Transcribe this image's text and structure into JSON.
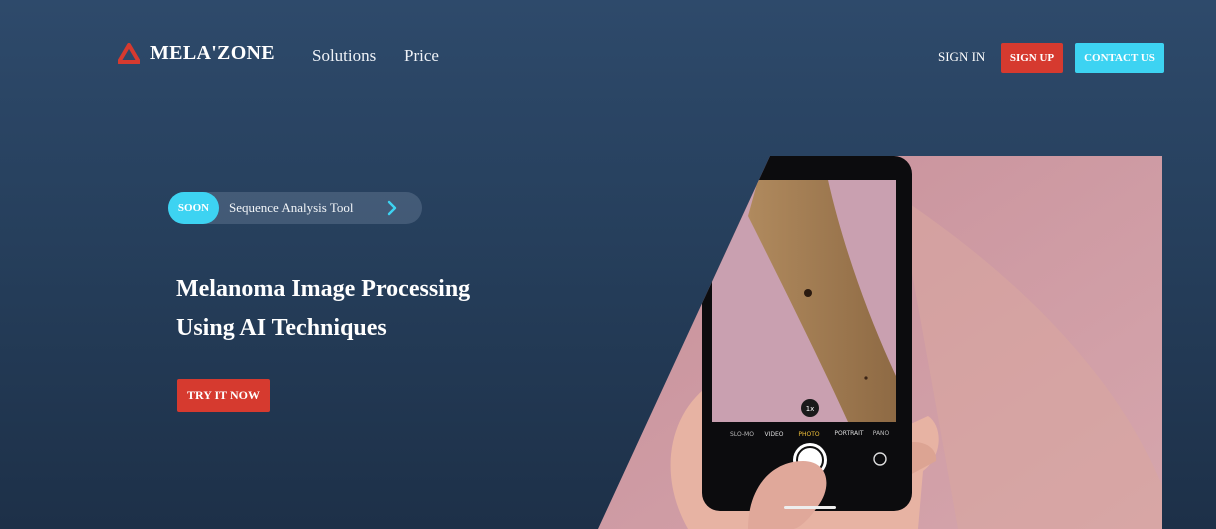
{
  "brand": {
    "name": "MELA'ZONE",
    "logo_icon": "triangle-logo-icon",
    "color": "#d63a2f"
  },
  "nav": {
    "links": [
      "Solutions",
      "Price"
    ],
    "sign_in": "SIGN IN",
    "sign_up": "SIGN UP",
    "contact": "CONTACT US"
  },
  "announcement": {
    "badge": "SOON",
    "text": "Sequence Analysis Tool",
    "icon": "chevron-right-icon"
  },
  "hero": {
    "title_line1": "Melanoma Image Processing",
    "title_line2": "Using AI Techniques",
    "cta": "TRY IT NOW",
    "camera_modes": [
      "SLO-MO",
      "VIDEO",
      "PHOTO",
      "PORTRAIT",
      "PANO"
    ],
    "zoom": "1x"
  },
  "colors": {
    "accent_red": "#d63a2f",
    "accent_cyan": "#3dd3f2",
    "background": "#263f5c"
  }
}
